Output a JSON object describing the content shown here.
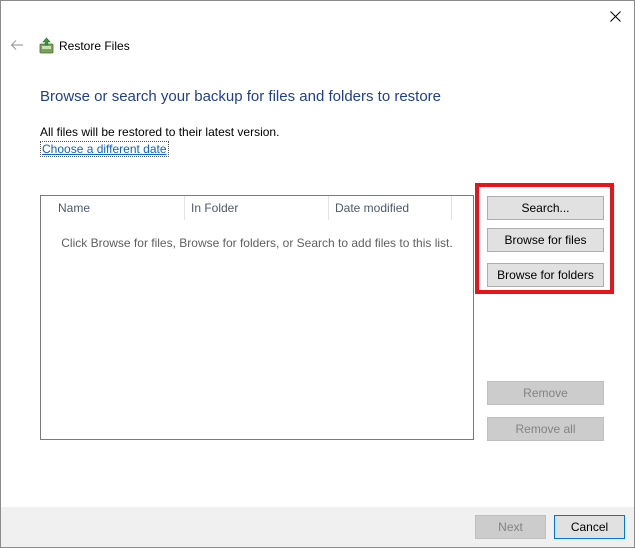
{
  "window": {
    "title": "Restore Files"
  },
  "header": {
    "heading": "Browse or search your backup for files and folders to restore",
    "info": "All files will be restored to their latest version.",
    "change_link": "Choose a different date"
  },
  "file_list": {
    "columns": [
      "Name",
      "In Folder",
      "Date modified"
    ],
    "empty_message": "Click Browse for files, Browse for folders, or Search to add files to this list."
  },
  "buttons": {
    "search": "Search...",
    "browse_files": "Browse for files",
    "browse_folders": "Browse for folders",
    "remove": "Remove",
    "remove_all": "Remove all",
    "next": "Next",
    "cancel": "Cancel"
  },
  "colors": {
    "heading": "#1f3f8f",
    "link": "#0b66c3",
    "highlight": "#e8141c"
  },
  "icons": {
    "back": "back-arrow-icon",
    "close": "close-icon",
    "app": "restore-files-icon"
  }
}
